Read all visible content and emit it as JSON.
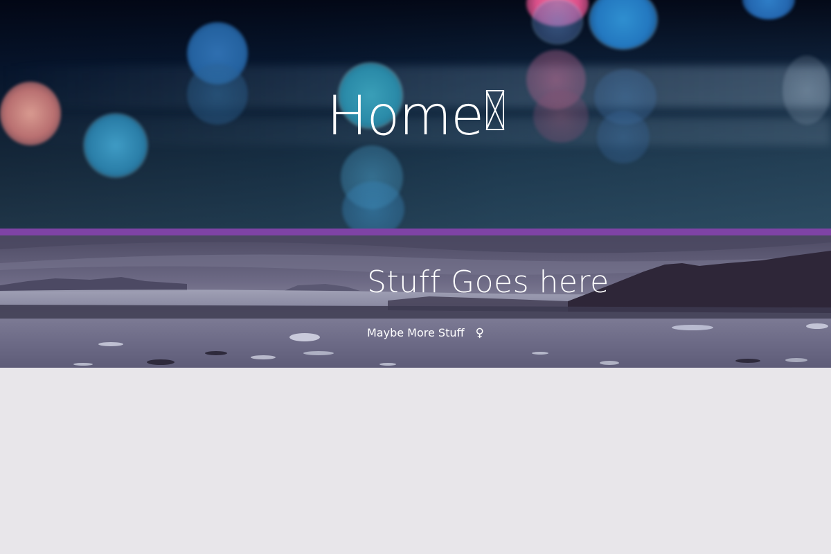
{
  "hero": {
    "title": "Home",
    "title_icon": "missing-glyph-icon"
  },
  "banner": {
    "title": "Stuff Goes here",
    "subtitle": "Maybe More Stuff",
    "subtitle_icon": "female-sign-icon",
    "subtitle_glyph": "♀"
  },
  "colors": {
    "accent_stripe": "#7f43a6",
    "page_background": "#e8e6ea",
    "text": "#ffffff"
  }
}
